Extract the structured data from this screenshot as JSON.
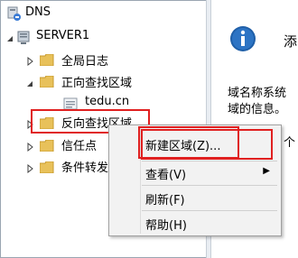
{
  "tree": {
    "root": "DNS",
    "server": "SERVER1",
    "global_logs": "全局日志",
    "forward_zones": "正向查找区域",
    "forward_zone_child": "tedu.cn",
    "reverse_zones": "反向查找区域",
    "trust_points": "信任点",
    "conditional_forwarders": "条件转发器"
  },
  "right_panel": {
    "title": "添",
    "desc_line1": "域名称系统",
    "desc_line2": "域的信息。",
    "trailing": "个"
  },
  "context_menu": {
    "items": [
      {
        "label": "新建区域(Z)..."
      },
      {
        "label": "查看(V)",
        "submenu_glyph": "▶"
      },
      {
        "label": "刷新(F)"
      },
      {
        "label": "帮助(H)"
      }
    ]
  },
  "colors": {
    "highlight_border": "#e02020",
    "folder": "#e8c15a",
    "info_icon": "#1f5fa8"
  }
}
